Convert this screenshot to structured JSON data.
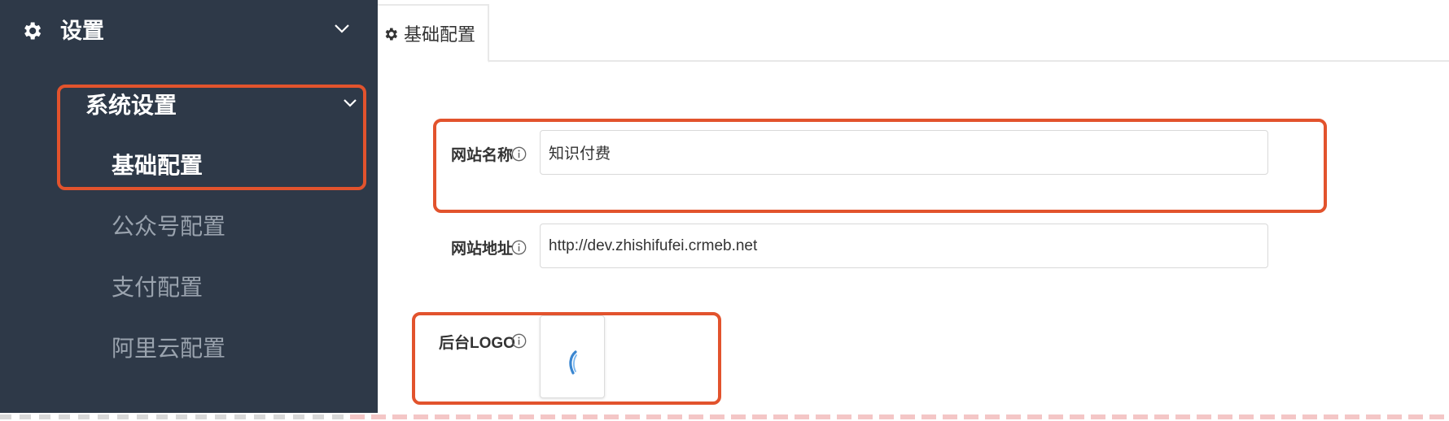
{
  "sidebar": {
    "top": {
      "label": "设置",
      "icon": "gear-icon"
    },
    "group": {
      "label": "系统设置"
    },
    "items": [
      {
        "label": "基础配置",
        "active": true
      },
      {
        "label": "公众号配置",
        "active": false
      },
      {
        "label": "支付配置",
        "active": false
      },
      {
        "label": "阿里云配置",
        "active": false
      }
    ]
  },
  "tabs": [
    {
      "label": "基础配置",
      "icon": "gear-icon",
      "active": true
    }
  ],
  "form": {
    "site_name": {
      "label": "网站名称",
      "value": "知识付费"
    },
    "site_url": {
      "label": "网站地址",
      "value": "http://dev.zhishifufei.crmeb.net"
    },
    "admin_logo": {
      "label": "后台LOGO"
    }
  },
  "colors": {
    "sidebar_bg": "#2e3948",
    "annotation": "#e2532d",
    "logo_blue": "#3a86d0"
  }
}
